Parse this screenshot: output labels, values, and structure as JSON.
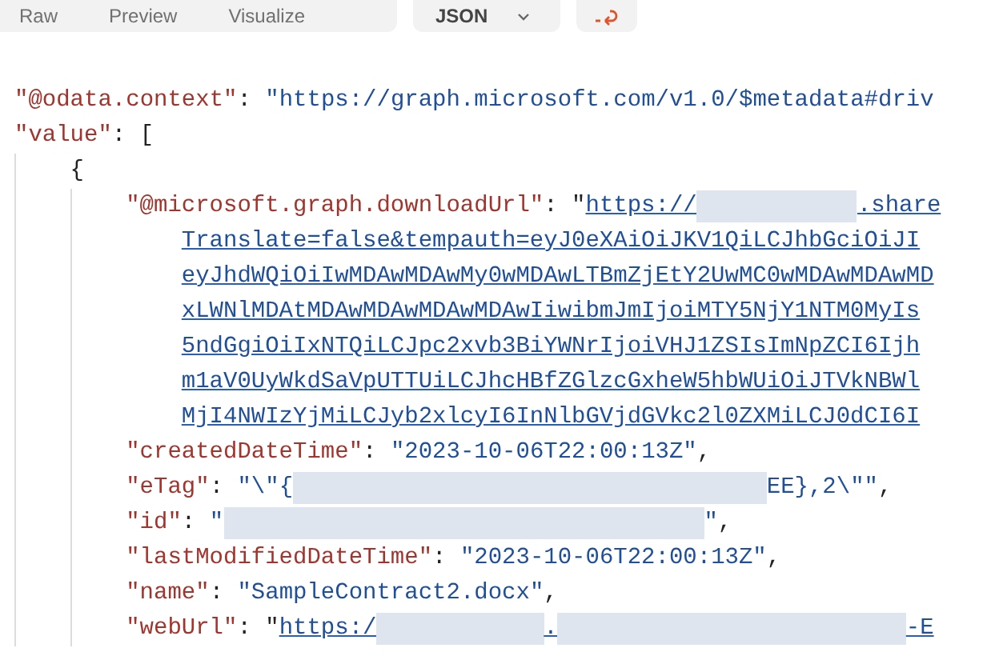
{
  "toolbar": {
    "view_tabs": [
      {
        "label": "Raw"
      },
      {
        "label": "Preview"
      },
      {
        "label": "Visualize"
      }
    ],
    "format_dropdown": {
      "value": "JSON"
    }
  },
  "body": {
    "lines": [
      {
        "segments": [
          {
            "kind": "key",
            "text": "\"@odata.context\""
          },
          {
            "kind": "punct",
            "text": ": "
          },
          {
            "kind": "string",
            "text": "\"https://graph.microsoft.com/v1.0/$metadata#driv"
          }
        ]
      },
      {
        "segments": [
          {
            "kind": "key",
            "text": "\"value\""
          },
          {
            "kind": "punct",
            "text": ": ["
          }
        ],
        "children": [
          {
            "segments": [
              {
                "kind": "punct",
                "text": "{"
              }
            ],
            "children": [
              {
                "segments": [
                  {
                    "kind": "key",
                    "text": "\"@microsoft.graph.downloadUrl\""
                  },
                  {
                    "kind": "punct",
                    "text": ": \""
                  },
                  {
                    "kind": "link",
                    "text": "https://"
                  },
                  {
                    "kind": "redacted"
                  },
                  {
                    "kind": "link",
                    "text": ".share"
                  }
                ],
                "continuation": [
                  {
                    "kind": "link",
                    "text": "Translate=false&tempauth=eyJ0eXAiOiJKV1QiLCJhbGciOiJI"
                  },
                  {
                    "kind": "link",
                    "text": "eyJhdWQiOiIwMDAwMDAwMy0wMDAwLTBmZjEtY2UwMC0wMDAwMDAwMD"
                  },
                  {
                    "kind": "link",
                    "text": "xLWNlMDAtMDAwMDAwMDAwMDAwIiwibmJmIjoiMTY5NjY1NTM0MyIs"
                  },
                  {
                    "kind": "link",
                    "text": "5ndGgiOiIxNTQiLCJpc2xvb3BiYWNrIjoiVHJ1ZSIsImNpZCI6Ijh"
                  },
                  {
                    "kind": "link",
                    "text": "m1aV0UyWkdSaVpUTTUiLCJhcHBfZGlzcGxheW5hbWUiOiJTVkNBWl"
                  },
                  {
                    "kind": "link",
                    "text": "MjI4NWIzYjMiLCJyb2xlcyI6InNlbGVjdGVkc2l0ZXMiLCJ0dCI6I"
                  }
                ]
              },
              {
                "segments": [
                  {
                    "kind": "key",
                    "text": "\"createdDateTime\""
                  },
                  {
                    "kind": "punct",
                    "text": ": "
                  },
                  {
                    "kind": "string",
                    "text": "\"2023-10-06T22:00:13Z\""
                  },
                  {
                    "kind": "punct",
                    "text": ","
                  }
                ]
              },
              {
                "segments": [
                  {
                    "kind": "key",
                    "text": "\"eTag\""
                  },
                  {
                    "kind": "punct",
                    "text": ": "
                  },
                  {
                    "kind": "string",
                    "text": "\"\\\"{"
                  },
                  {
                    "kind": "redacted"
                  },
                  {
                    "kind": "string",
                    "text": "EE},2\\\"\""
                  },
                  {
                    "kind": "punct",
                    "text": ","
                  }
                ]
              },
              {
                "segments": [
                  {
                    "kind": "key",
                    "text": "\"id\""
                  },
                  {
                    "kind": "punct",
                    "text": ": "
                  },
                  {
                    "kind": "string",
                    "text": "\""
                  },
                  {
                    "kind": "redacted"
                  },
                  {
                    "kind": "string",
                    "text": "\""
                  },
                  {
                    "kind": "punct",
                    "text": ","
                  }
                ]
              },
              {
                "segments": [
                  {
                    "kind": "key",
                    "text": "\"lastModifiedDateTime\""
                  },
                  {
                    "kind": "punct",
                    "text": ": "
                  },
                  {
                    "kind": "string",
                    "text": "\"2023-10-06T22:00:13Z\""
                  },
                  {
                    "kind": "punct",
                    "text": ","
                  }
                ]
              },
              {
                "segments": [
                  {
                    "kind": "key",
                    "text": "\"name\""
                  },
                  {
                    "kind": "punct",
                    "text": ": "
                  },
                  {
                    "kind": "string",
                    "text": "\"SampleContract2.docx\""
                  },
                  {
                    "kind": "punct",
                    "text": ","
                  }
                ]
              },
              {
                "segments": [
                  {
                    "kind": "key",
                    "text": "\"webUrl\""
                  },
                  {
                    "kind": "punct",
                    "text": ": \""
                  },
                  {
                    "kind": "link",
                    "text": "https:/"
                  },
                  {
                    "kind": "redacted"
                  },
                  {
                    "kind": "link",
                    "text": "."
                  },
                  {
                    "kind": "redacted"
                  },
                  {
                    "kind": "link",
                    "text": "-E"
                  }
                ]
              }
            ]
          }
        ]
      }
    ]
  }
}
